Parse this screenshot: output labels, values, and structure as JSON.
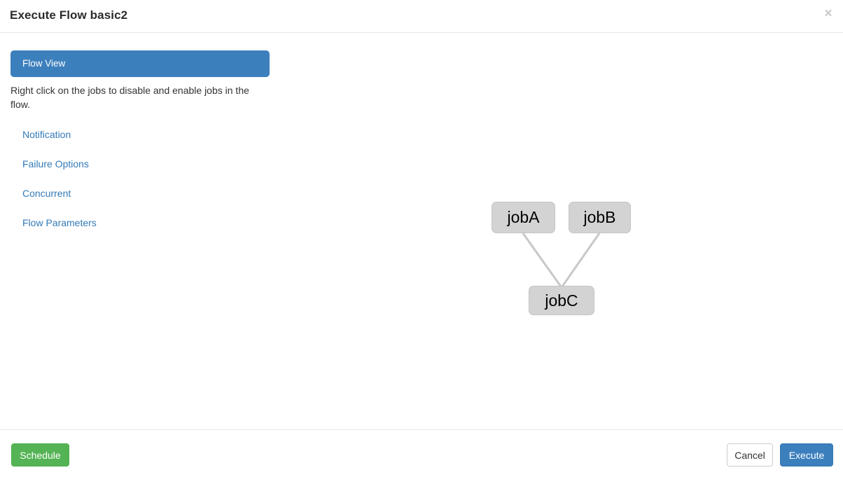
{
  "header": {
    "title": "Execute Flow basic2",
    "close_label": "×"
  },
  "sidebar": {
    "active_tab": "Flow View",
    "description": "Right click on the jobs to disable and enable jobs in the flow.",
    "items": [
      {
        "label": "Notification"
      },
      {
        "label": "Failure Options"
      },
      {
        "label": "Concurrent"
      },
      {
        "label": "Flow Parameters"
      }
    ]
  },
  "flow": {
    "nodes": [
      {
        "id": "jobA",
        "label": "jobA"
      },
      {
        "id": "jobB",
        "label": "jobB"
      },
      {
        "id": "jobC",
        "label": "jobC"
      }
    ],
    "edges": [
      {
        "from": "jobA",
        "to": "jobC"
      },
      {
        "from": "jobB",
        "to": "jobC"
      }
    ]
  },
  "footer": {
    "schedule_label": "Schedule",
    "cancel_label": "Cancel",
    "execute_label": "Execute"
  },
  "colors": {
    "accent_blue": "#3c7fbd",
    "link_blue": "#337ab7",
    "success_green": "#54b354",
    "node_fill": "#d3d3d3",
    "edge_stroke": "#c8c8c8"
  }
}
